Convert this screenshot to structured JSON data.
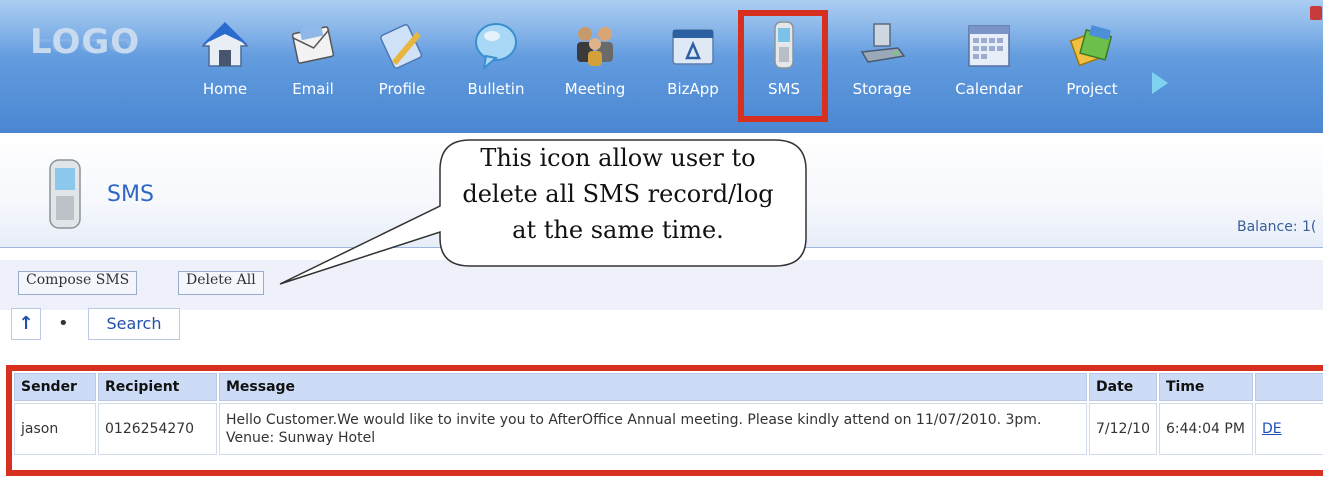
{
  "app": {
    "logo_text": "LOGO"
  },
  "nav": {
    "items": [
      {
        "label": "Home",
        "icon": "home-icon"
      },
      {
        "label": "Email",
        "icon": "email-icon"
      },
      {
        "label": "Profile",
        "icon": "profile-icon"
      },
      {
        "label": "Bulletin",
        "icon": "bulletin-icon"
      },
      {
        "label": "Meeting",
        "icon": "meeting-icon"
      },
      {
        "label": "BizApp",
        "icon": "bizapp-icon"
      },
      {
        "label": "SMS",
        "icon": "mobile-phone-icon",
        "selected": true
      },
      {
        "label": "Storage",
        "icon": "storage-icon"
      },
      {
        "label": "Calendar",
        "icon": "calendar-icon"
      },
      {
        "label": "Project",
        "icon": "project-icon"
      }
    ],
    "more_icon": "chevron-right-icon"
  },
  "page": {
    "title": "SMS",
    "balance_label": "Balance: 1("
  },
  "toolbar": {
    "compose_label": "Compose SMS",
    "delete_all_label": "Delete All",
    "up_label": "↑",
    "separator": "•",
    "search_label": "Search"
  },
  "callout": {
    "lines": [
      "This icon allow user to",
      "delete all SMS record/log",
      "at the same time."
    ]
  },
  "table": {
    "headers": [
      "Sender",
      "Recipient",
      "Message",
      "Date",
      "Time",
      ""
    ],
    "rows": [
      {
        "sender": "jason",
        "recipient": "0126254270",
        "message": "Hello Customer.We would like to invite you to AfterOffice Annual meeting. Please kindly attend on 11/07/2010. 3pm. Venue: Sunway Hotel",
        "date": "7/12/10",
        "time": "6:44:04 PM",
        "action": "DE"
      }
    ]
  },
  "colors": {
    "topbar": "#5d97dc",
    "highlight_frame": "#d8301e",
    "title_blue": "#2f66c5",
    "header_cell": "#cddcf6"
  }
}
